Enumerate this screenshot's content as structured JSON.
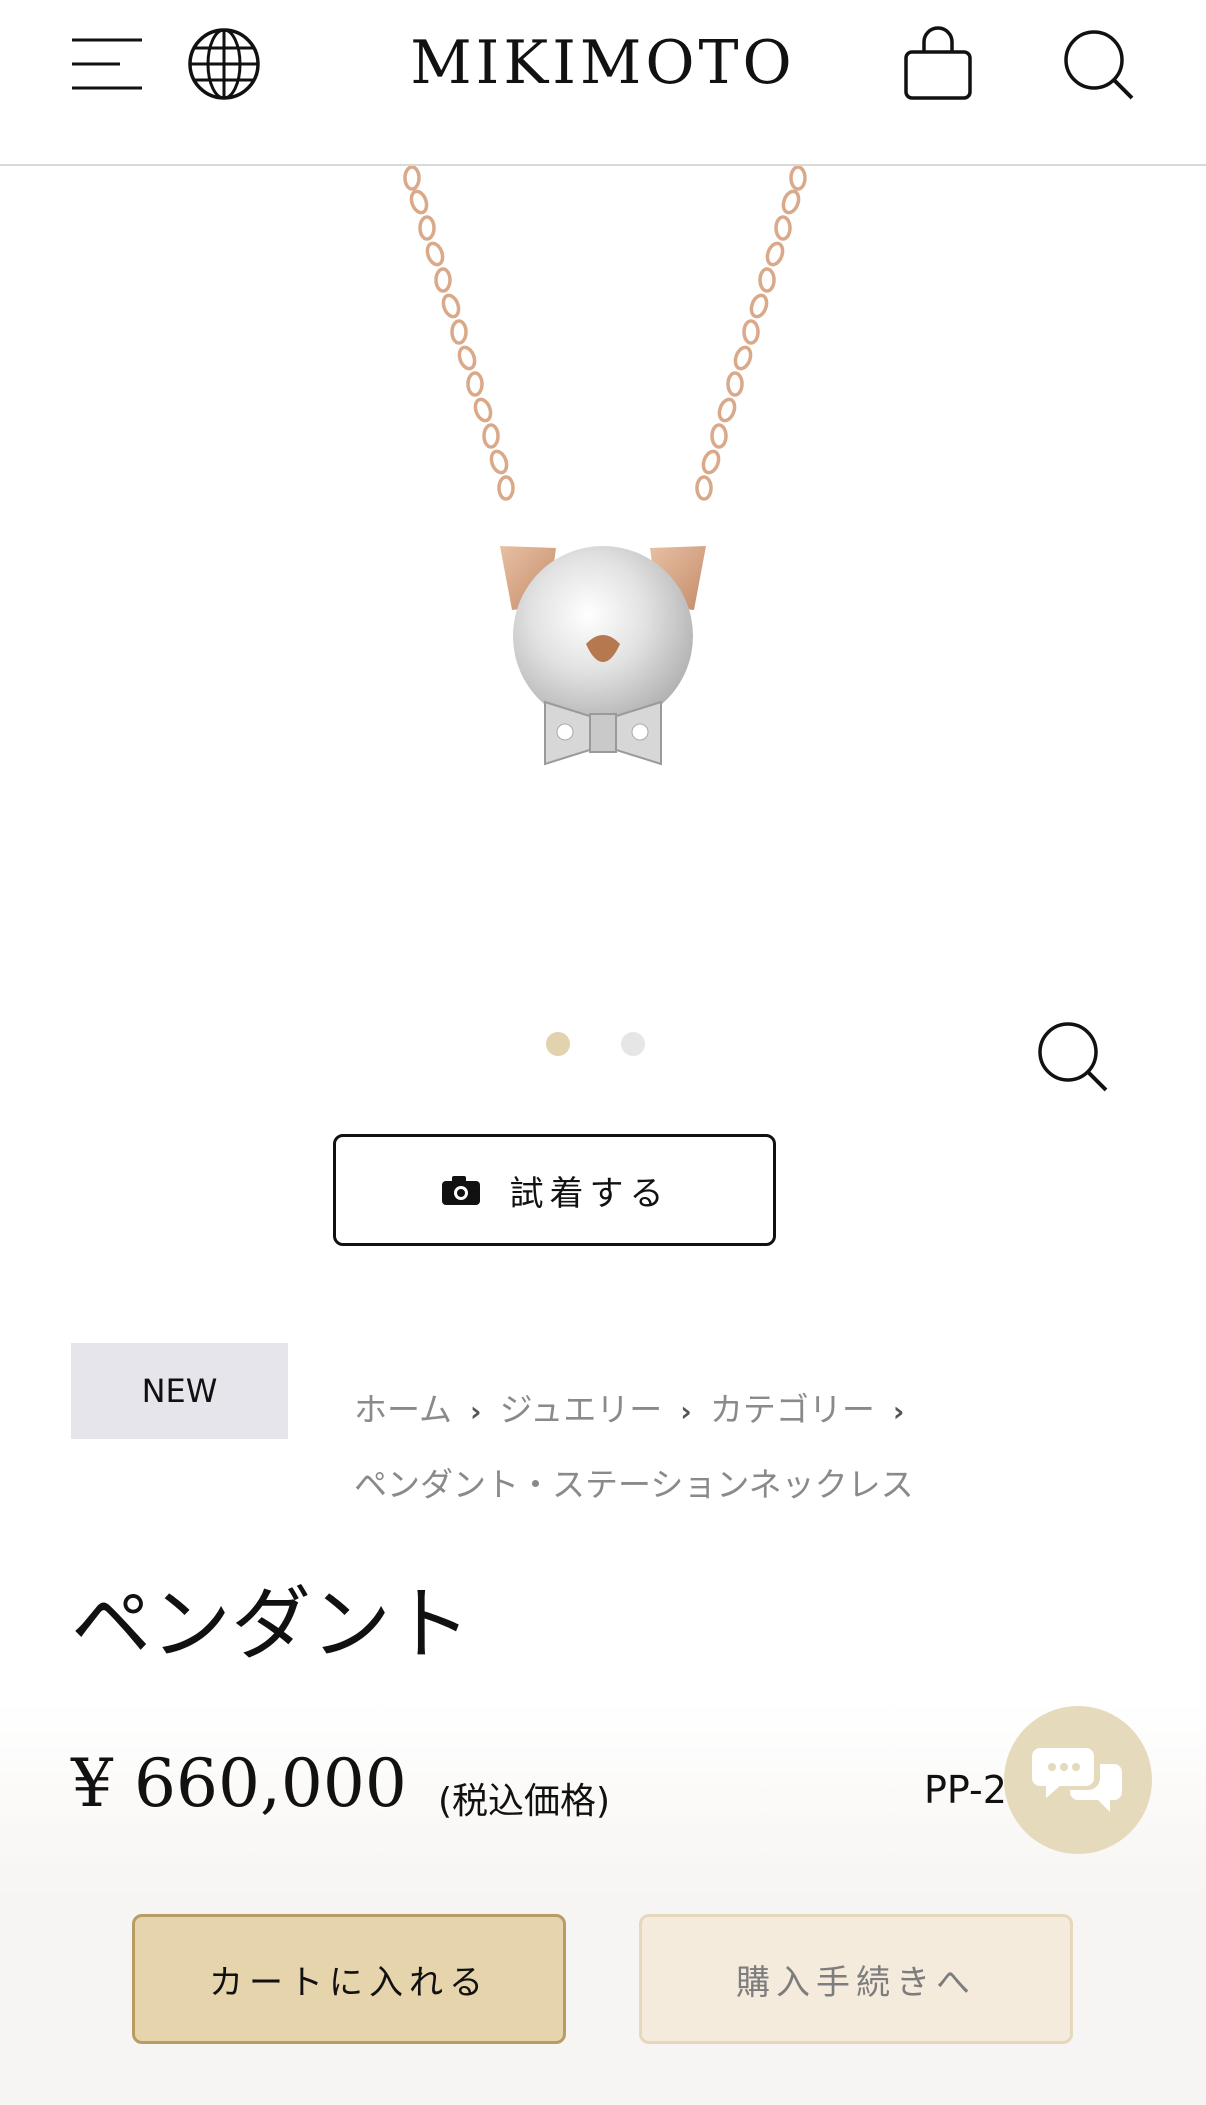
{
  "header": {
    "brand": "MIKIMOTO",
    "icons": [
      "hamburger-menu-icon",
      "globe-icon",
      "shopping-bag-icon",
      "search-icon"
    ]
  },
  "gallery": {
    "slides_total": 2,
    "active_slide": 1,
    "zoom_icon": "zoom-search-icon"
  },
  "tryon": {
    "label": "試着する",
    "icon": "camera-icon"
  },
  "product": {
    "badge": "NEW",
    "breadcrumb": [
      "ホーム",
      "ジュエリー",
      "カテゴリー",
      "ペンダント・ステーションネックレス"
    ],
    "title": "ペンダント",
    "price": "¥ 660,000",
    "tax_note": "(税込価格)",
    "sku": "PP-2"
  },
  "chat": {
    "icon": "chat-bubbles-icon"
  },
  "actions": {
    "add_to_cart": "カートに入れる",
    "checkout": "購入手続きへ"
  },
  "colors": {
    "accent_gold": "#e6d4ac",
    "accent_gold_border": "#b79d63",
    "checkout_bg": "#f4ebdd",
    "badge_bg": "#e6e5ec",
    "dot_active": "#e2d3ae",
    "chain_rose_gold": "#d9a98a"
  }
}
